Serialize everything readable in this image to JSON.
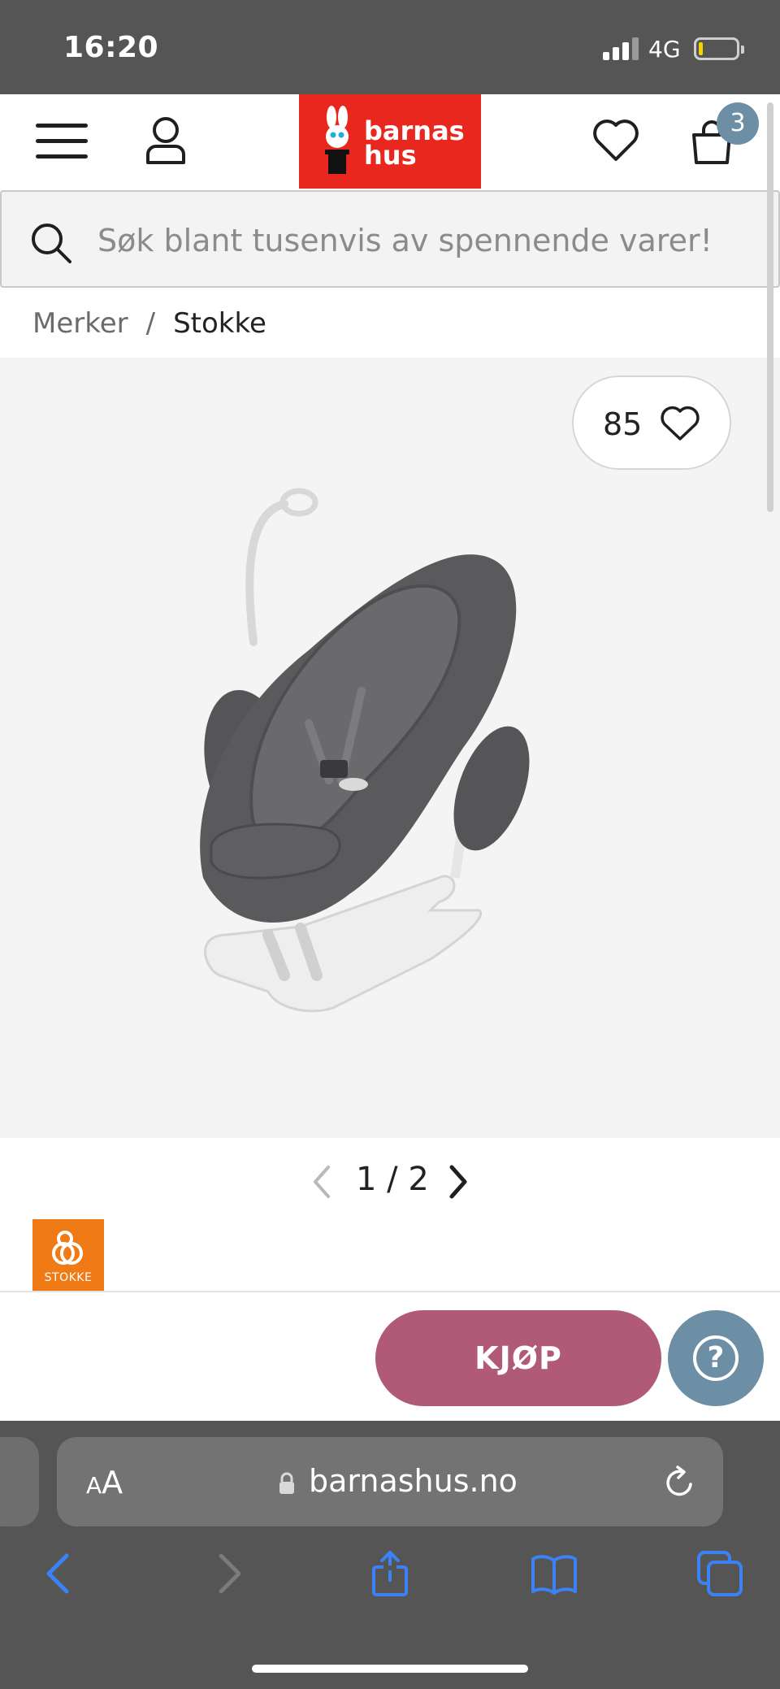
{
  "status_bar": {
    "time": "16:20",
    "network": "4G",
    "battery_level": 0.1,
    "battery_color": "#f5d000"
  },
  "header": {
    "menu_icon": "hamburger-icon",
    "account_icon": "user-icon",
    "logo": {
      "line1": "barnas",
      "line2": "hus",
      "background": "#e8281f"
    },
    "wishlist_icon": "heart-icon",
    "cart_icon": "shopping-bag-icon",
    "cart_count": "3",
    "badge_color": "#6d8fa6"
  },
  "search": {
    "placeholder": "Søk blant tusenvis av spennende varer!",
    "value": ""
  },
  "breadcrumb": {
    "items": [
      "Merker",
      "Stokke"
    ],
    "separator": "/"
  },
  "product": {
    "like_count": "85",
    "image_alt": "grey baby bouncer with white base and toy arch",
    "brand": "STOKKE",
    "brand_color": "#f07a16"
  },
  "gallery": {
    "current": "1",
    "separator": "/",
    "total": "2"
  },
  "actions": {
    "buy_label": "KJØP",
    "buy_color": "#b05a78",
    "help_label": "?"
  },
  "browser": {
    "text_size_small": "A",
    "text_size_large": "A",
    "url": "barnashus.no",
    "toolbar_icons": [
      "back-icon",
      "forward-icon",
      "share-icon",
      "bookmarks-icon",
      "tabs-icon"
    ],
    "accent": "#3b82f6"
  }
}
